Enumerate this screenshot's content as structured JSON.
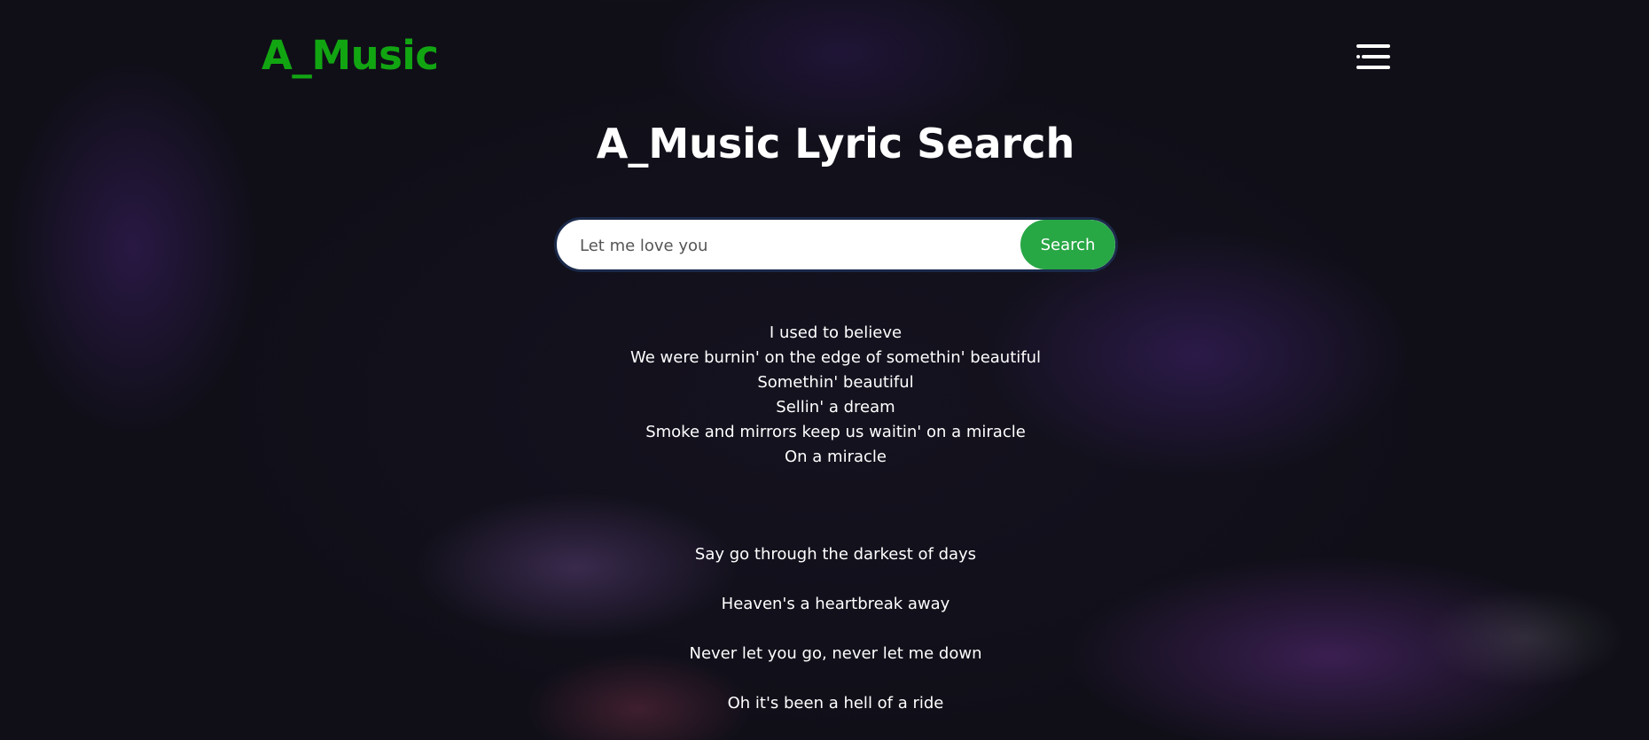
{
  "header": {
    "logo": "A_Music",
    "menu_icon": "hamburger-menu-icon"
  },
  "main": {
    "title": "A_Music Lyric Search",
    "search": {
      "value": "Let me love you",
      "button_label": "Search"
    },
    "lyrics": {
      "verse_lines": [
        "I used to believe",
        "We were burnin' on the edge of somethin' beautiful",
        "Somethin' beautiful",
        "Sellin' a dream",
        "Smoke and mirrors keep us waitin' on a miracle",
        "On a miracle"
      ],
      "spaced_lines": [
        "Say go through the darkest of days",
        "Heaven's a heartbreak away",
        "Never let you go, never let me down",
        "Oh it's been a hell of a ride"
      ]
    }
  },
  "colors": {
    "logo": "#12a512",
    "search_button": "#28a745",
    "background": "#100f18"
  }
}
